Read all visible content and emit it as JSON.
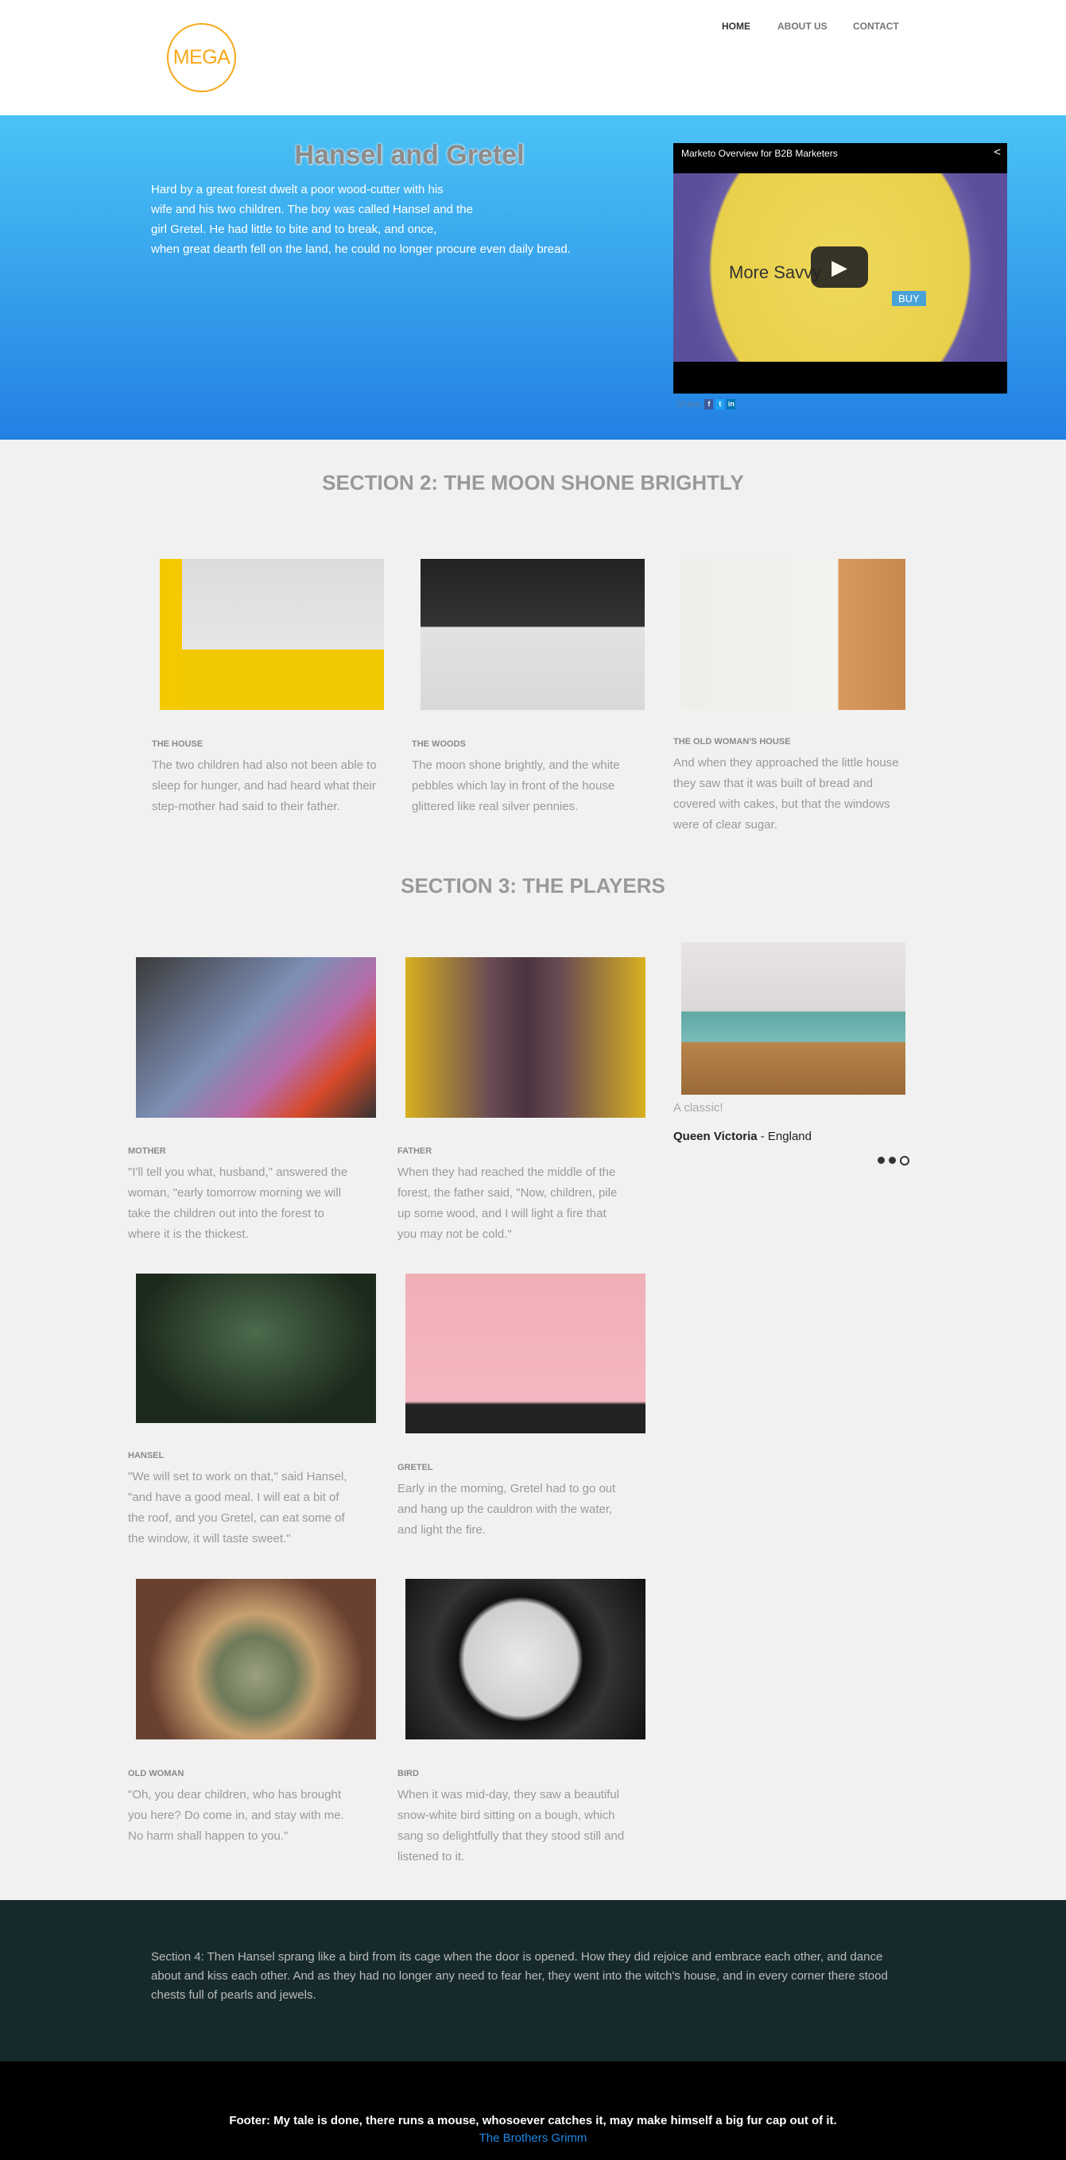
{
  "header": {
    "logo": "MEGA",
    "nav": [
      "HOME",
      "ABOUT US",
      "CONTACT"
    ]
  },
  "hero": {
    "title": "Hansel and Gretel",
    "lines": [
      "Hard by a great forest dwelt a poor wood-cutter with his",
      "wife and his two children. The boy was called Hansel and the",
      "girl Gretel. He had little to bite and to break, and once,",
      "when great dearth fell on the land, he could no longer procure even daily bread."
    ],
    "video": {
      "title": "Marketo Overview for B2B Marketers",
      "thumb_text": "More Savvy",
      "buy": "BUY",
      "share_label": "Share:"
    }
  },
  "section2": {
    "heading": "SECTION 2: THE MOON SHONE BRIGHTLY",
    "items": [
      {
        "label": "THE HOUSE",
        "text": "The two children had also not been able to sleep for hunger, and had heard what their step-mother had said to their father."
      },
      {
        "label": "THE WOODS",
        "text": "The moon shone brightly, and the white pebbles which lay in front of the house glittered like real silver pennies."
      },
      {
        "label": "THE OLD WOMAN'S HOUSE",
        "text": "And when they approached the little house they saw that it was built of bread and covered with cakes, but that the windows were of clear sugar."
      }
    ]
  },
  "section3": {
    "heading": "SECTION 3: THE PLAYERS",
    "players": [
      {
        "label": "MOTHER",
        "text": "\"I'll tell you what, husband,\" answered the woman, \"early tomorrow morning we will take the children out into the forest to where it is the thickest."
      },
      {
        "label": "FATHER",
        "text": "When they had reached the middle of the forest, the father said, \"Now, children, pile up some wood, and I will light a fire that you may not be cold.\""
      },
      {
        "label": "HANSEL",
        "text": "\"We will set to work on that,\" said Hansel, \"and have a good meal. I will eat a bit of the roof, and you Gretel, can eat some of the window, it will taste sweet.\""
      },
      {
        "label": "GRETEL",
        "text": "Early in the morning, Gretel had to go out and hang up the cauldron with the water, and light the fire."
      },
      {
        "label": "OLD WOMAN",
        "text": "\"Oh, you dear children, who has brought you here? Do come in, and stay with me. No harm shall happen to you.\""
      },
      {
        "label": "BIRD",
        "text": "When it was mid-day, they saw a beautiful snow-white bird sitting on a bough, which sang so delightfully that they stood still and listened to it."
      }
    ],
    "testimonial": {
      "quote": "A classic!",
      "name": "Queen Victoria",
      "place": " - England",
      "slides": 3,
      "active_slide": 3
    }
  },
  "section4": {
    "text": "Section 4: Then Hansel sprang like a bird from its cage when the door is opened. How they did rejoice and embrace each other, and dance about and kiss each other. And as they had no longer any need to fear her, they went into the witch's house, and in every corner there stood chests full of pearls and jewels."
  },
  "footer": {
    "text": "Footer: My tale is done, there runs a mouse, whosoever catches it, may make himself a big fur cap out of it.",
    "link": "The Brothers Grimm"
  },
  "colors": {
    "accent": "#f7a81b",
    "hero_top": "#4bc3f5",
    "hero_bottom": "#2280e3",
    "section4_bg": "#162a2c",
    "link": "#1e88e5"
  }
}
